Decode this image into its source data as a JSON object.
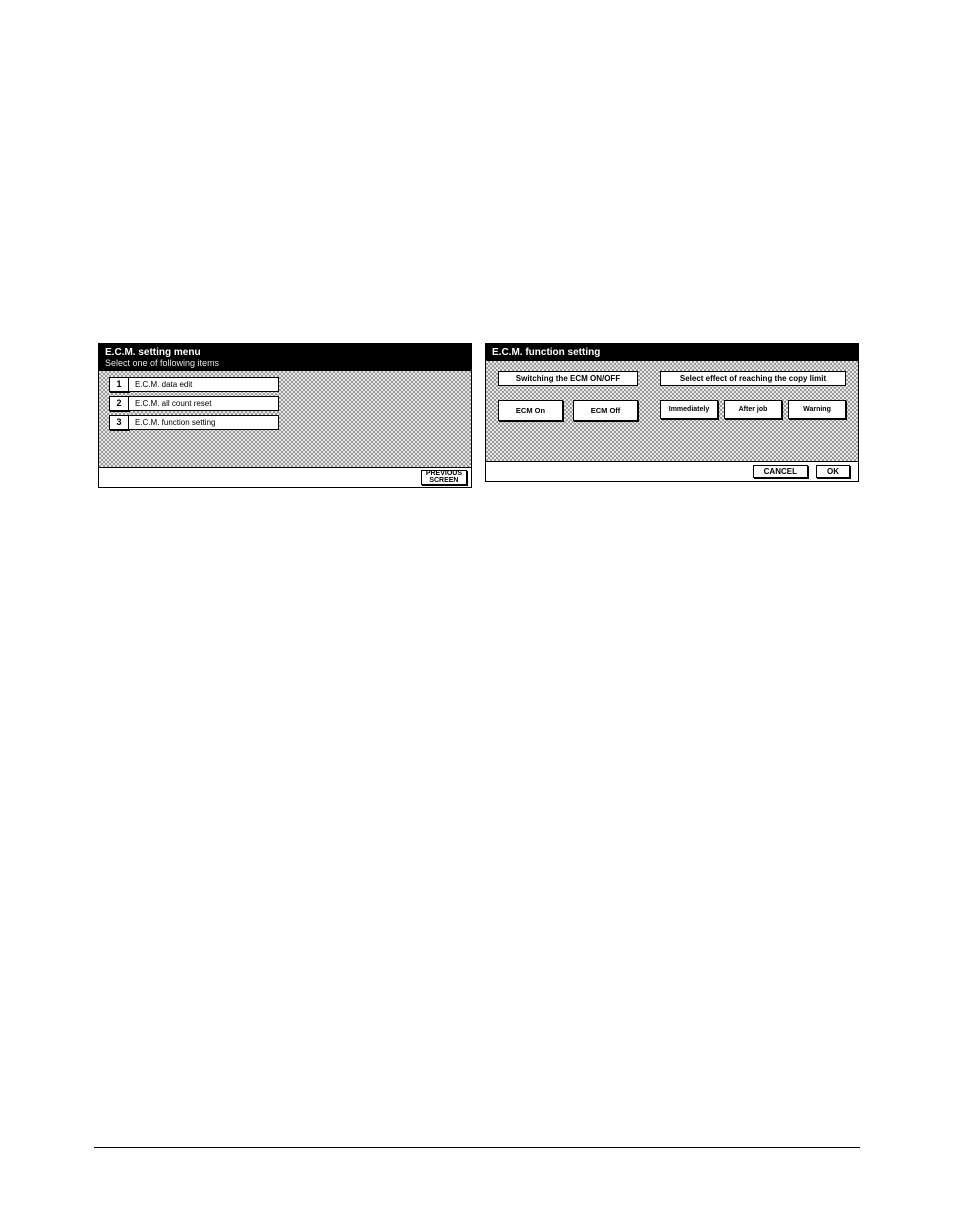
{
  "left_panel": {
    "title": "E.C.M. setting menu",
    "subtitle": "Select one of following items",
    "items": [
      {
        "num": "1",
        "label": "E.C.M. data edit"
      },
      {
        "num": "2",
        "label": "E.C.M. all count reset"
      },
      {
        "num": "3",
        "label": "E.C.M. function setting"
      }
    ],
    "footer_button_line1": "PREVIOUS",
    "footer_button_line2": "SCREEN"
  },
  "right_panel": {
    "title": "E.C.M. function setting",
    "group_switch": {
      "label": "Switching the ECM ON/OFF",
      "options": [
        "ECM On",
        "ECM Off"
      ]
    },
    "group_effect": {
      "label": "Select effect of reaching the copy limit",
      "options": [
        "Immediately",
        "After job",
        "Warning"
      ]
    },
    "footer": {
      "cancel": "CANCEL",
      "ok": "OK"
    }
  }
}
